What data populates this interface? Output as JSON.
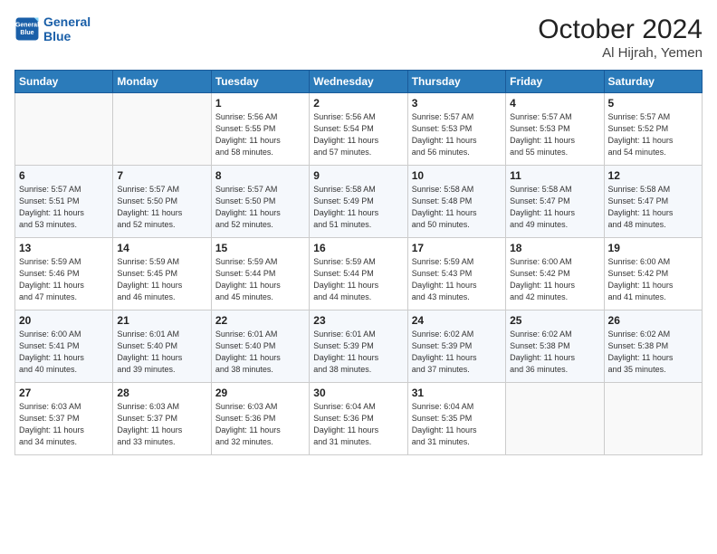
{
  "logo": {
    "line1": "General",
    "line2": "Blue"
  },
  "header": {
    "month": "October 2024",
    "location": "Al Hijrah, Yemen"
  },
  "weekdays": [
    "Sunday",
    "Monday",
    "Tuesday",
    "Wednesday",
    "Thursday",
    "Friday",
    "Saturday"
  ],
  "weeks": [
    [
      {
        "day": "",
        "info": ""
      },
      {
        "day": "",
        "info": ""
      },
      {
        "day": "1",
        "info": "Sunrise: 5:56 AM\nSunset: 5:55 PM\nDaylight: 11 hours\nand 58 minutes."
      },
      {
        "day": "2",
        "info": "Sunrise: 5:56 AM\nSunset: 5:54 PM\nDaylight: 11 hours\nand 57 minutes."
      },
      {
        "day": "3",
        "info": "Sunrise: 5:57 AM\nSunset: 5:53 PM\nDaylight: 11 hours\nand 56 minutes."
      },
      {
        "day": "4",
        "info": "Sunrise: 5:57 AM\nSunset: 5:53 PM\nDaylight: 11 hours\nand 55 minutes."
      },
      {
        "day": "5",
        "info": "Sunrise: 5:57 AM\nSunset: 5:52 PM\nDaylight: 11 hours\nand 54 minutes."
      }
    ],
    [
      {
        "day": "6",
        "info": "Sunrise: 5:57 AM\nSunset: 5:51 PM\nDaylight: 11 hours\nand 53 minutes."
      },
      {
        "day": "7",
        "info": "Sunrise: 5:57 AM\nSunset: 5:50 PM\nDaylight: 11 hours\nand 52 minutes."
      },
      {
        "day": "8",
        "info": "Sunrise: 5:57 AM\nSunset: 5:50 PM\nDaylight: 11 hours\nand 52 minutes."
      },
      {
        "day": "9",
        "info": "Sunrise: 5:58 AM\nSunset: 5:49 PM\nDaylight: 11 hours\nand 51 minutes."
      },
      {
        "day": "10",
        "info": "Sunrise: 5:58 AM\nSunset: 5:48 PM\nDaylight: 11 hours\nand 50 minutes."
      },
      {
        "day": "11",
        "info": "Sunrise: 5:58 AM\nSunset: 5:47 PM\nDaylight: 11 hours\nand 49 minutes."
      },
      {
        "day": "12",
        "info": "Sunrise: 5:58 AM\nSunset: 5:47 PM\nDaylight: 11 hours\nand 48 minutes."
      }
    ],
    [
      {
        "day": "13",
        "info": "Sunrise: 5:59 AM\nSunset: 5:46 PM\nDaylight: 11 hours\nand 47 minutes."
      },
      {
        "day": "14",
        "info": "Sunrise: 5:59 AM\nSunset: 5:45 PM\nDaylight: 11 hours\nand 46 minutes."
      },
      {
        "day": "15",
        "info": "Sunrise: 5:59 AM\nSunset: 5:44 PM\nDaylight: 11 hours\nand 45 minutes."
      },
      {
        "day": "16",
        "info": "Sunrise: 5:59 AM\nSunset: 5:44 PM\nDaylight: 11 hours\nand 44 minutes."
      },
      {
        "day": "17",
        "info": "Sunrise: 5:59 AM\nSunset: 5:43 PM\nDaylight: 11 hours\nand 43 minutes."
      },
      {
        "day": "18",
        "info": "Sunrise: 6:00 AM\nSunset: 5:42 PM\nDaylight: 11 hours\nand 42 minutes."
      },
      {
        "day": "19",
        "info": "Sunrise: 6:00 AM\nSunset: 5:42 PM\nDaylight: 11 hours\nand 41 minutes."
      }
    ],
    [
      {
        "day": "20",
        "info": "Sunrise: 6:00 AM\nSunset: 5:41 PM\nDaylight: 11 hours\nand 40 minutes."
      },
      {
        "day": "21",
        "info": "Sunrise: 6:01 AM\nSunset: 5:40 PM\nDaylight: 11 hours\nand 39 minutes."
      },
      {
        "day": "22",
        "info": "Sunrise: 6:01 AM\nSunset: 5:40 PM\nDaylight: 11 hours\nand 38 minutes."
      },
      {
        "day": "23",
        "info": "Sunrise: 6:01 AM\nSunset: 5:39 PM\nDaylight: 11 hours\nand 38 minutes."
      },
      {
        "day": "24",
        "info": "Sunrise: 6:02 AM\nSunset: 5:39 PM\nDaylight: 11 hours\nand 37 minutes."
      },
      {
        "day": "25",
        "info": "Sunrise: 6:02 AM\nSunset: 5:38 PM\nDaylight: 11 hours\nand 36 minutes."
      },
      {
        "day": "26",
        "info": "Sunrise: 6:02 AM\nSunset: 5:38 PM\nDaylight: 11 hours\nand 35 minutes."
      }
    ],
    [
      {
        "day": "27",
        "info": "Sunrise: 6:03 AM\nSunset: 5:37 PM\nDaylight: 11 hours\nand 34 minutes."
      },
      {
        "day": "28",
        "info": "Sunrise: 6:03 AM\nSunset: 5:37 PM\nDaylight: 11 hours\nand 33 minutes."
      },
      {
        "day": "29",
        "info": "Sunrise: 6:03 AM\nSunset: 5:36 PM\nDaylight: 11 hours\nand 32 minutes."
      },
      {
        "day": "30",
        "info": "Sunrise: 6:04 AM\nSunset: 5:36 PM\nDaylight: 11 hours\nand 31 minutes."
      },
      {
        "day": "31",
        "info": "Sunrise: 6:04 AM\nSunset: 5:35 PM\nDaylight: 11 hours\nand 31 minutes."
      },
      {
        "day": "",
        "info": ""
      },
      {
        "day": "",
        "info": ""
      }
    ]
  ]
}
